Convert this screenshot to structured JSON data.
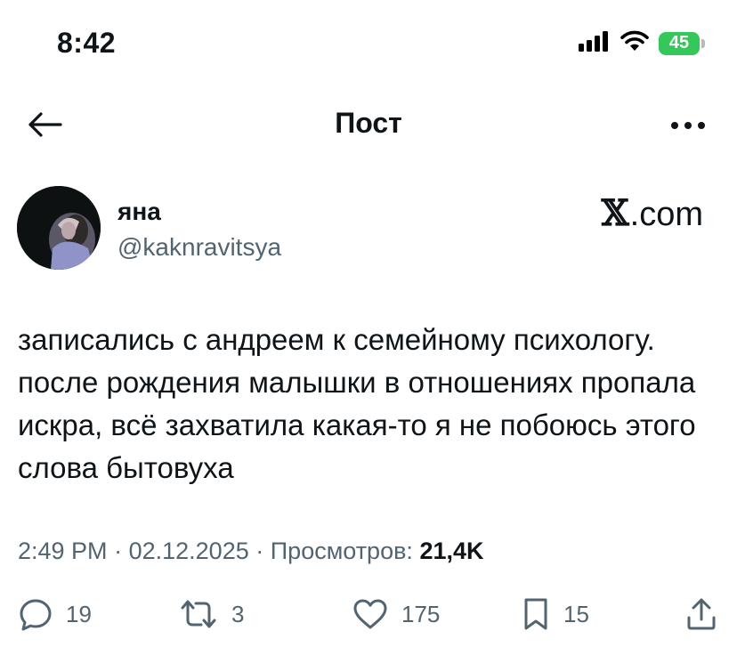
{
  "status_bar": {
    "time": "8:42",
    "battery": "45",
    "icons": [
      "cellular-signal-icon",
      "wifi-icon",
      "battery-icon"
    ]
  },
  "header": {
    "title": "Пост",
    "back_icon": "arrow-left-icon",
    "more_icon": "more-horizontal-icon"
  },
  "author": {
    "display_name": "яна",
    "handle": "@kaknravitsya"
  },
  "watermark": {
    "logo": "𝕏",
    "text": ".com"
  },
  "tweet": {
    "text": "записались с андреем к семейному психологу. после рождения малышки в отношениях пропала искра, всё захватила какая-то я не побоюсь этого слова бытовуха"
  },
  "meta": {
    "time": "2:49 PM",
    "separator": "·",
    "date": "02.12.2025",
    "views_label": "Просмотров:",
    "views_count": "21,4K"
  },
  "actions": {
    "replies": "19",
    "retweets": "3",
    "likes": "175",
    "bookmarks": "15"
  }
}
